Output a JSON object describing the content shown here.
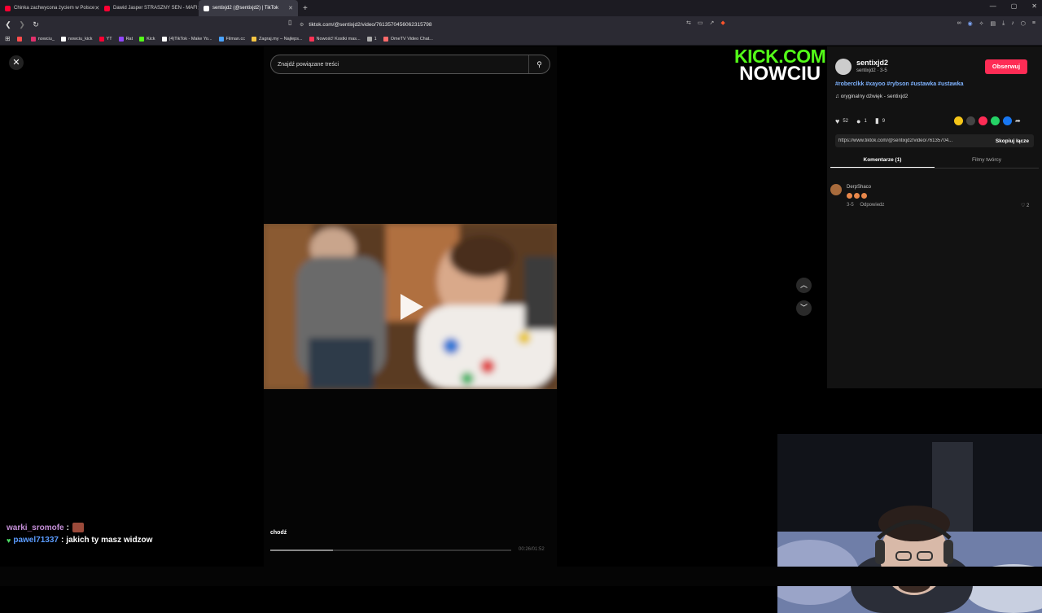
{
  "tabs": [
    {
      "title": "Chinka zachwycona życiem w Polsce",
      "color": "#ff0033",
      "active": false
    },
    {
      "title": "Dawid Jasper STRASZNY SEN - MAFI",
      "color": "#ff0033",
      "active": false
    },
    {
      "title": "sentixjd2 (@sentixjd2) | TikTok",
      "color": "#ffffff",
      "active": true
    }
  ],
  "new_tab": "+",
  "url": "tiktok.com/@sentixjd2/video/7613570456062315798",
  "bookmarks": [
    {
      "label": "",
      "color": "#ff4d4d"
    },
    {
      "label": "nowciu_",
      "color": "#e1306c"
    },
    {
      "label": "nowciu_kick",
      "color": "#ffffff"
    },
    {
      "label": "YT",
      "color": "#ff0033"
    },
    {
      "label": "Rat",
      "color": "#9146ff"
    },
    {
      "label": "Kick",
      "color": "#53fc18"
    },
    {
      "label": "(4)TikTok - Make Yo...",
      "color": "#ffffff"
    },
    {
      "label": "Filman.cc",
      "color": "#4aa3ff"
    },
    {
      "label": "Zagraj.my – Najleps...",
      "color": "#f5c542"
    },
    {
      "label": "Nowość! Kostki mas...",
      "color": "#ff3355"
    },
    {
      "label": "1",
      "color": "#aaaaaa"
    },
    {
      "label": "OmeTV Video Chat...",
      "color": "#ff6b6b"
    }
  ],
  "search": {
    "placeholder": "Znajdź powiązane treści"
  },
  "video": {
    "caption": "chodź",
    "time": "00:26/01:52",
    "progress": 0.26
  },
  "chat": [
    {
      "user": "warki_sromofe",
      "sep": ":",
      "msg": ""
    },
    {
      "user": "pawel71337",
      "sep": ":",
      "msg": "jakich ty masz widzow"
    }
  ],
  "overlay": {
    "kick_line1": "KICK.COM",
    "kick_line2": "NOWCIU"
  },
  "profile": {
    "username": "sentixjd2",
    "subtitle": "sentixjd2 · 3-5",
    "follow_label": "Obserwuj",
    "hashtags": "#roberclkk #xayoo #rybson #ustawka #ustawka",
    "sound": "oryginalny dźwięk - sentixjd2",
    "likes": "52",
    "comments": "1",
    "saves": "9",
    "share_link": "https://www.tiktok.com/@sentixjd2/video/76135704...",
    "copy_label": "Skopiuj łącze",
    "tab_comments": "Komentarze (1)",
    "tab_videos": "Filmy twórcy"
  },
  "comment": {
    "user": "DerpShaco",
    "date": "3-5",
    "reply_label": "Odpowiedz",
    "likes": "2"
  },
  "colors": {
    "accent": "#fe2c55",
    "kick_green": "#53fc18",
    "hashtag_blue": "#7fb3ff"
  }
}
